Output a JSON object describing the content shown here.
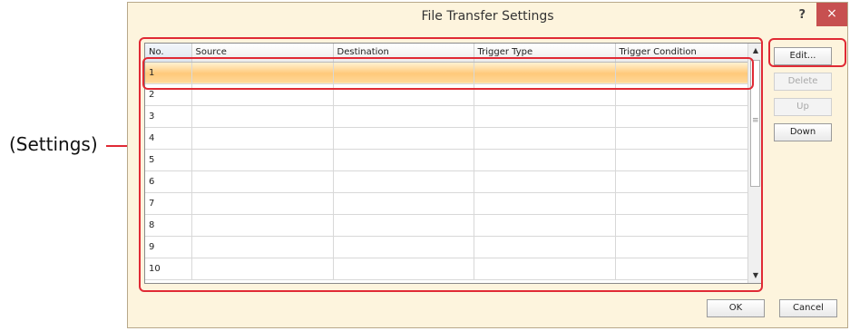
{
  "annotation": {
    "label": "(Settings)"
  },
  "dialog": {
    "title": "File Transfer Settings",
    "help": "?",
    "close": "×"
  },
  "table": {
    "columns": [
      "No.",
      "Source",
      "Destination",
      "Trigger Type",
      "Trigger Condition"
    ],
    "rows": [
      "1",
      "2",
      "3",
      "4",
      "5",
      "6",
      "7",
      "8",
      "9",
      "10"
    ],
    "selected_row": 1
  },
  "buttons": {
    "edit": "Edit...",
    "delete": "Delete",
    "up": "Up",
    "down": "Down",
    "ok": "OK",
    "cancel": "Cancel"
  },
  "colors": {
    "highlight": "#e02a35",
    "selected_row": "#ffc97a",
    "dialog_bg": "#fdf4dd"
  }
}
